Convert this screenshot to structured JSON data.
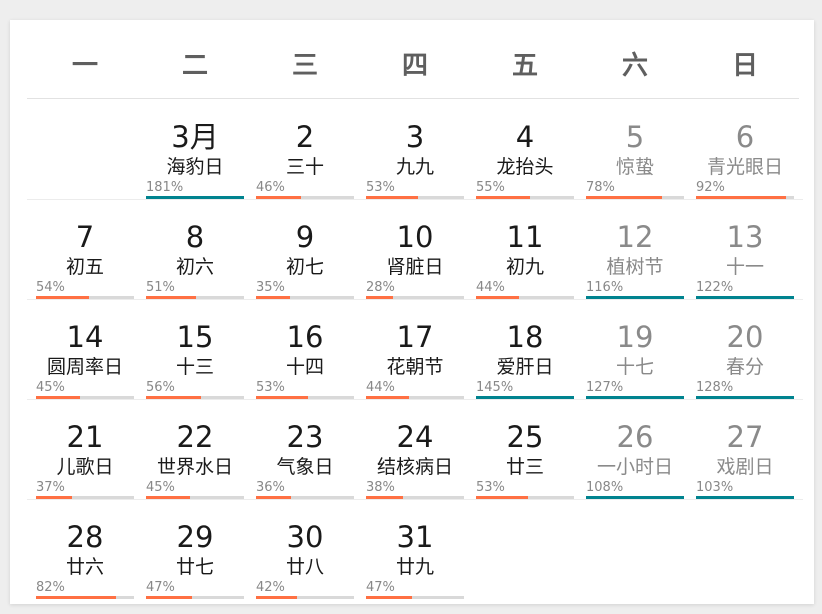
{
  "calendar": {
    "weekdays": [
      "一",
      "二",
      "三",
      "四",
      "五",
      "六",
      "日"
    ],
    "colors": {
      "normal_bar": "#ff7043",
      "over_100_bar": "#00838f",
      "track": "#d9d9d9",
      "weekend_text": "#8a8a8a"
    },
    "weeks": [
      [
        null,
        {
          "day": "3月",
          "lunar": "海豹日",
          "percent": "181%",
          "value": 181
        },
        {
          "day": "2",
          "lunar": "三十",
          "percent": "46%",
          "value": 46
        },
        {
          "day": "3",
          "lunar": "九九",
          "percent": "53%",
          "value": 53
        },
        {
          "day": "4",
          "lunar": "龙抬头",
          "percent": "55%",
          "value": 55
        },
        {
          "day": "5",
          "lunar": "惊蛰",
          "percent": "78%",
          "value": 78
        },
        {
          "day": "6",
          "lunar": "青光眼日",
          "percent": "92%",
          "value": 92
        }
      ],
      [
        {
          "day": "7",
          "lunar": "初五",
          "percent": "54%",
          "value": 54
        },
        {
          "day": "8",
          "lunar": "初六",
          "percent": "51%",
          "value": 51
        },
        {
          "day": "9",
          "lunar": "初七",
          "percent": "35%",
          "value": 35
        },
        {
          "day": "10",
          "lunar": "肾脏日",
          "percent": "28%",
          "value": 28
        },
        {
          "day": "11",
          "lunar": "初九",
          "percent": "44%",
          "value": 44
        },
        {
          "day": "12",
          "lunar": "植树节",
          "percent": "116%",
          "value": 116
        },
        {
          "day": "13",
          "lunar": "十一",
          "percent": "122%",
          "value": 122
        }
      ],
      [
        {
          "day": "14",
          "lunar": "圆周率日",
          "percent": "45%",
          "value": 45
        },
        {
          "day": "15",
          "lunar": "十三",
          "percent": "56%",
          "value": 56
        },
        {
          "day": "16",
          "lunar": "十四",
          "percent": "53%",
          "value": 53
        },
        {
          "day": "17",
          "lunar": "花朝节",
          "percent": "44%",
          "value": 44
        },
        {
          "day": "18",
          "lunar": "爱肝日",
          "percent": "145%",
          "value": 145
        },
        {
          "day": "19",
          "lunar": "十七",
          "percent": "127%",
          "value": 127
        },
        {
          "day": "20",
          "lunar": "春分",
          "percent": "128%",
          "value": 128
        }
      ],
      [
        {
          "day": "21",
          "lunar": "儿歌日",
          "percent": "37%",
          "value": 37
        },
        {
          "day": "22",
          "lunar": "世界水日",
          "percent": "45%",
          "value": 45
        },
        {
          "day": "23",
          "lunar": "气象日",
          "percent": "36%",
          "value": 36
        },
        {
          "day": "24",
          "lunar": "结核病日",
          "percent": "38%",
          "value": 38
        },
        {
          "day": "25",
          "lunar": "廿三",
          "percent": "53%",
          "value": 53
        },
        {
          "day": "26",
          "lunar": "一小时日",
          "percent": "108%",
          "value": 108
        },
        {
          "day": "27",
          "lunar": "戏剧日",
          "percent": "103%",
          "value": 103
        }
      ],
      [
        {
          "day": "28",
          "lunar": "廿六",
          "percent": "82%",
          "value": 82
        },
        {
          "day": "29",
          "lunar": "廿七",
          "percent": "47%",
          "value": 47
        },
        {
          "day": "30",
          "lunar": "廿八",
          "percent": "42%",
          "value": 42
        },
        {
          "day": "31",
          "lunar": "廿九",
          "percent": "47%",
          "value": 47
        },
        null,
        null,
        null
      ]
    ]
  }
}
